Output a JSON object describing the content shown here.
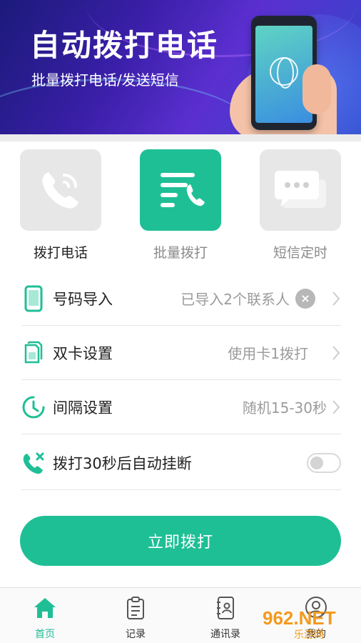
{
  "banner": {
    "title": "自动拨打电话",
    "subtitle": "批量拨打电话/发送短信"
  },
  "features": [
    {
      "label": "拨打电话",
      "icon": "phone-call-icon",
      "active": false
    },
    {
      "label": "批量拨打",
      "icon": "batch-dial-icon",
      "active": true
    },
    {
      "label": "短信定时",
      "icon": "sms-chat-icon",
      "active": false
    }
  ],
  "settings": {
    "import": {
      "title": "号码导入",
      "value": "已导入2个联系人",
      "icon": "phone-import-icon",
      "clear": "×"
    },
    "dual_sim": {
      "title": "双卡设置",
      "value": "使用卡1拨打",
      "icon": "sim-card-icon"
    },
    "interval": {
      "title": "间隔设置",
      "value": "随机15-30秒",
      "icon": "clock-icon"
    },
    "auto_hangup": {
      "title": "拨打30秒后自动挂断",
      "icon": "hangup-icon",
      "enabled": false
    }
  },
  "cta": {
    "label": "立即拨打"
  },
  "nav": [
    {
      "label": "首页",
      "icon": "home-icon",
      "active": true
    },
    {
      "label": "记录",
      "icon": "clipboard-icon",
      "active": false
    },
    {
      "label": "通讯录",
      "icon": "address-book-icon",
      "active": false
    },
    {
      "label": "我的",
      "icon": "user-icon",
      "active": false
    }
  ],
  "watermark": {
    "main": "962.NET",
    "sub": "乐游网"
  },
  "colors": {
    "accent": "#1fbf96",
    "banner": "#3a1fa8",
    "tile_inactive": "#e7e7e7"
  }
}
